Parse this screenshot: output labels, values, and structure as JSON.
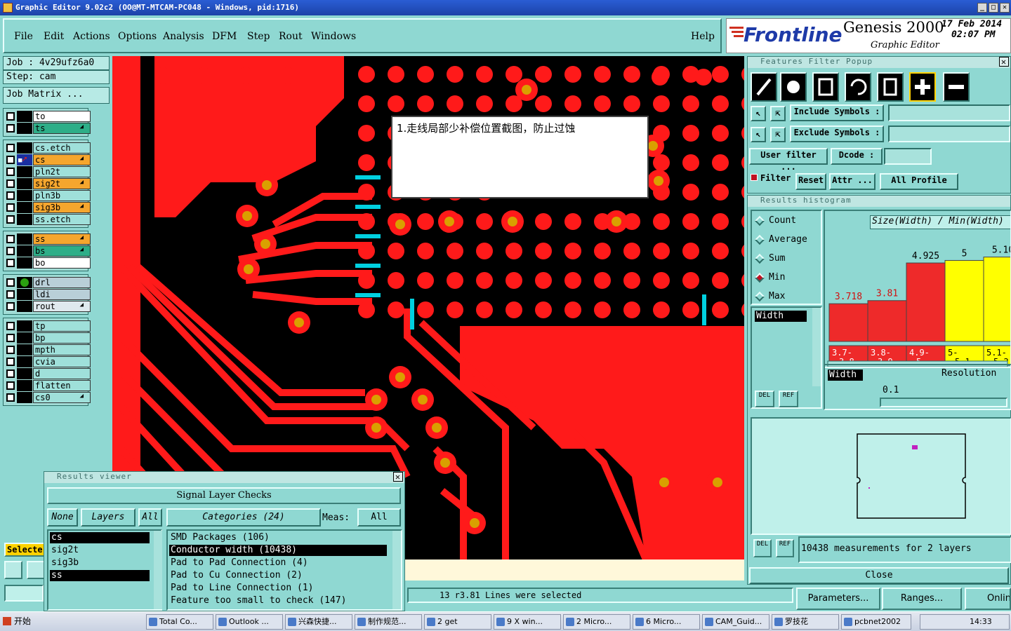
{
  "window": {
    "title": "Graphic Editor 9.02c2  (OO@MT-MTCAM-PC048 - Windows, pid:1716)"
  },
  "menu": [
    "File",
    "Edit",
    "Actions",
    "Options",
    "Analysis",
    "DFM",
    "Step",
    "Rout",
    "Windows",
    "Help"
  ],
  "brand": {
    "logo": "Frontline",
    "product": "Genesis 2000",
    "subtitle": "Graphic Editor",
    "date": "17 Feb 2014",
    "time": "02:07 PM"
  },
  "job": {
    "job": "Job : 4v29ufz6a0",
    "step": "Step: cam",
    "matrix_btn": "Job Matrix ..."
  },
  "layers": [
    {
      "name": "to",
      "color": "#ffffff"
    },
    {
      "name": "ts",
      "color": "#2eae88",
      "mark": "⬋"
    },
    {
      "name": "cs.etch",
      "color": "#9fe0da"
    },
    {
      "name": "cs",
      "color": "#f5a62e",
      "mark": "⬋▦",
      "active": true
    },
    {
      "name": "pln2t",
      "color": "#9fe0da"
    },
    {
      "name": "sig2t",
      "color": "#f5a62e",
      "mark": "⬋"
    },
    {
      "name": "pln3b",
      "color": "#9fe0da"
    },
    {
      "name": "sig3b",
      "color": "#f5a62e",
      "mark": "⬋"
    },
    {
      "name": "ss.etch",
      "color": "#9fe0da"
    },
    {
      "name": "ss",
      "color": "#f5a62e",
      "mark": "⬋"
    },
    {
      "name": "bs",
      "color": "#2eae88",
      "mark": "⬋"
    },
    {
      "name": "bo",
      "color": "#ffffff"
    },
    {
      "name": "drl",
      "color": "#b9cfd8",
      "dot": true
    },
    {
      "name": "ldi",
      "color": "#b9cfd8"
    },
    {
      "name": "rout",
      "color": "#dfe9ee",
      "mark": "⬋"
    },
    {
      "name": "tp",
      "color": "#9fe0da"
    },
    {
      "name": "bp",
      "color": "#9fe0da"
    },
    {
      "name": "mpth",
      "color": "#9fe0da"
    },
    {
      "name": "cvia",
      "color": "#9fe0da"
    },
    {
      "name": "d",
      "color": "#9fe0da"
    },
    {
      "name": "flatten",
      "color": "#9fe0da"
    },
    {
      "name": "cs0",
      "color": "#9fe0da",
      "mark": "⬋"
    }
  ],
  "select_btn": "Selecte",
  "annotation": "1.走线局部少补偿位置截图，防止过蚀",
  "status": "13 r3.81 Lines were selected",
  "filter": {
    "title": "Features Filter Popup",
    "include": "Include Symbols :",
    "exclude": "Exclude Symbols :",
    "user_filter": "User filter ...",
    "dcode": "Dcode :",
    "filter": "Filter",
    "reset": "Reset",
    "attr": "Attr ...",
    "profile": "All Profile"
  },
  "histogram": {
    "title": "Results histogram",
    "modes": [
      "Count",
      "Average",
      "Sum",
      "Min",
      "Max"
    ],
    "selected": "Min",
    "header": "Size(Width) / Min(Width)",
    "attribute": "Width",
    "resolution_label": "Resolution",
    "resolution": "0.1",
    "summary": "10438 measurements for 2 layers",
    "close": "Close",
    "buttons": [
      "Parameters...",
      "Ranges...",
      "Onlin"
    ]
  },
  "chart_data": {
    "type": "bar",
    "categories": [
      "3.7-3.8",
      "3.8-3.9",
      "4.9-5",
      "5-5.1",
      "5.1-5.2"
    ],
    "values": [
      3.718,
      3.81,
      4.925,
      5,
      5.1
    ],
    "value_labels": [
      "3.718",
      "3.81",
      "4.925",
      "5",
      "5.10"
    ],
    "colors": [
      "#ee2a2a",
      "#ee2a2a",
      "#ee2a2a",
      "#ffff00",
      "#ffff00"
    ],
    "ylim": [
      2.6,
      5.3
    ],
    "title": "Size(Width) / Min(Width)"
  },
  "results": {
    "title": "Results viewer",
    "header": "Signal Layer Checks",
    "none": "None",
    "layers_btn": "Layers",
    "all": "All",
    "categories_btn": "Categories (24)",
    "meas": "Meas:",
    "meas_val": "All",
    "layers": [
      "cs",
      "sig2t",
      "sig3b",
      "ss"
    ],
    "items": [
      "SMD Packages (106)",
      "Conductor width (10438)",
      "Pad to Pad Connection (4)",
      "Pad to Cu Connection (2)",
      "Pad to Line Connection (1)",
      "Feature too small to check (147)"
    ]
  },
  "taskbar": {
    "start": "开始",
    "tasks": [
      "Total Co...",
      "Outlook ...",
      "兴森快捷...",
      "制作规范...",
      "2 get",
      "9 X win...",
      "2 Micro...",
      "6 Micro...",
      "CAM_Guid...",
      "罗技花",
      "pcbnet2002"
    ],
    "clock": "14:33"
  }
}
